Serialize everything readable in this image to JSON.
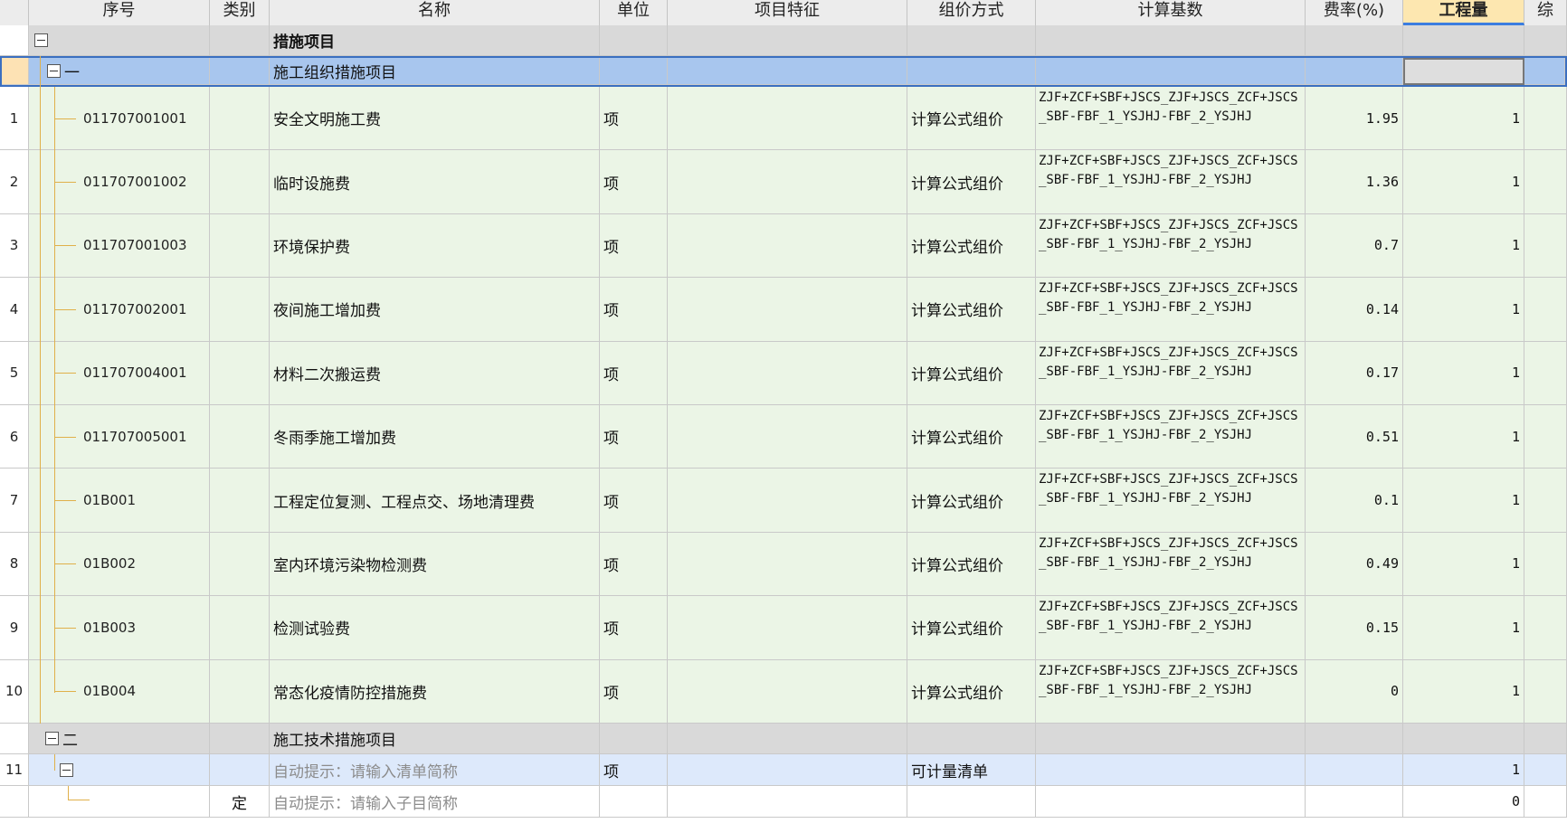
{
  "header": {
    "columns": [
      "序号",
      "类别",
      "名称",
      "单位",
      "项目特征",
      "组价方式",
      "计算基数",
      "费率(%)",
      "工程量",
      "综"
    ]
  },
  "root": {
    "name": "措施项目"
  },
  "group1": {
    "code": "一",
    "name": "施工组织措施项目"
  },
  "items": [
    {
      "rowno": "1",
      "code": "011707001001",
      "name": "安全文明施工费",
      "unit": "项",
      "method": "计算公式组价",
      "base": "ZJF+ZCF+SBF+JSCS_ZJF+JSCS_ZCF+JSCS_SBF-FBF_1_YSJHJ-FBF_2_YSJHJ",
      "rate": "1.95",
      "qty": "1"
    },
    {
      "rowno": "2",
      "code": "011707001002",
      "name": "临时设施费",
      "unit": "项",
      "method": "计算公式组价",
      "base": "ZJF+ZCF+SBF+JSCS_ZJF+JSCS_ZCF+JSCS_SBF-FBF_1_YSJHJ-FBF_2_YSJHJ",
      "rate": "1.36",
      "qty": "1"
    },
    {
      "rowno": "3",
      "code": "011707001003",
      "name": "环境保护费",
      "unit": "项",
      "method": "计算公式组价",
      "base": "ZJF+ZCF+SBF+JSCS_ZJF+JSCS_ZCF+JSCS_SBF-FBF_1_YSJHJ-FBF_2_YSJHJ",
      "rate": "0.7",
      "qty": "1"
    },
    {
      "rowno": "4",
      "code": "011707002001",
      "name": "夜间施工增加费",
      "unit": "项",
      "method": "计算公式组价",
      "base": "ZJF+ZCF+SBF+JSCS_ZJF+JSCS_ZCF+JSCS_SBF-FBF_1_YSJHJ-FBF_2_YSJHJ",
      "rate": "0.14",
      "qty": "1"
    },
    {
      "rowno": "5",
      "code": "011707004001",
      "name": "材料二次搬运费",
      "unit": "项",
      "method": "计算公式组价",
      "base": "ZJF+ZCF+SBF+JSCS_ZJF+JSCS_ZCF+JSCS_SBF-FBF_1_YSJHJ-FBF_2_YSJHJ",
      "rate": "0.17",
      "qty": "1"
    },
    {
      "rowno": "6",
      "code": "011707005001",
      "name": "冬雨季施工增加费",
      "unit": "项",
      "method": "计算公式组价",
      "base": "ZJF+ZCF+SBF+JSCS_ZJF+JSCS_ZCF+JSCS_SBF-FBF_1_YSJHJ-FBF_2_YSJHJ",
      "rate": "0.51",
      "qty": "1"
    },
    {
      "rowno": "7",
      "code": "01B001",
      "name": "工程定位复测、工程点交、场地清理费",
      "unit": "项",
      "method": "计算公式组价",
      "base": "ZJF+ZCF+SBF+JSCS_ZJF+JSCS_ZCF+JSCS_SBF-FBF_1_YSJHJ-FBF_2_YSJHJ",
      "rate": "0.1",
      "qty": "1"
    },
    {
      "rowno": "8",
      "code": "01B002",
      "name": "室内环境污染物检测费",
      "unit": "项",
      "method": "计算公式组价",
      "base": "ZJF+ZCF+SBF+JSCS_ZJF+JSCS_ZCF+JSCS_SBF-FBF_1_YSJHJ-FBF_2_YSJHJ",
      "rate": "0.49",
      "qty": "1"
    },
    {
      "rowno": "9",
      "code": "01B003",
      "name": "检测试验费",
      "unit": "项",
      "method": "计算公式组价",
      "base": "ZJF+ZCF+SBF+JSCS_ZJF+JSCS_ZCF+JSCS_SBF-FBF_1_YSJHJ-FBF_2_YSJHJ",
      "rate": "0.15",
      "qty": "1"
    },
    {
      "rowno": "10",
      "code": "01B004",
      "name": "常态化疫情防控措施费",
      "unit": "项",
      "method": "计算公式组价",
      "base": "ZJF+ZCF+SBF+JSCS_ZJF+JSCS_ZCF+JSCS_SBF-FBF_1_YSJHJ-FBF_2_YSJHJ",
      "rate": "0",
      "qty": "1"
    }
  ],
  "group2": {
    "code": "二",
    "name": "施工技术措施项目"
  },
  "row11": {
    "rowno": "11",
    "name": "自动提示：请输入清单简称",
    "unit": "项",
    "method": "可计量清单",
    "qty": "1"
  },
  "subrow": {
    "category": "定",
    "name": "自动提示：请输入子目简称",
    "qty": "0"
  }
}
